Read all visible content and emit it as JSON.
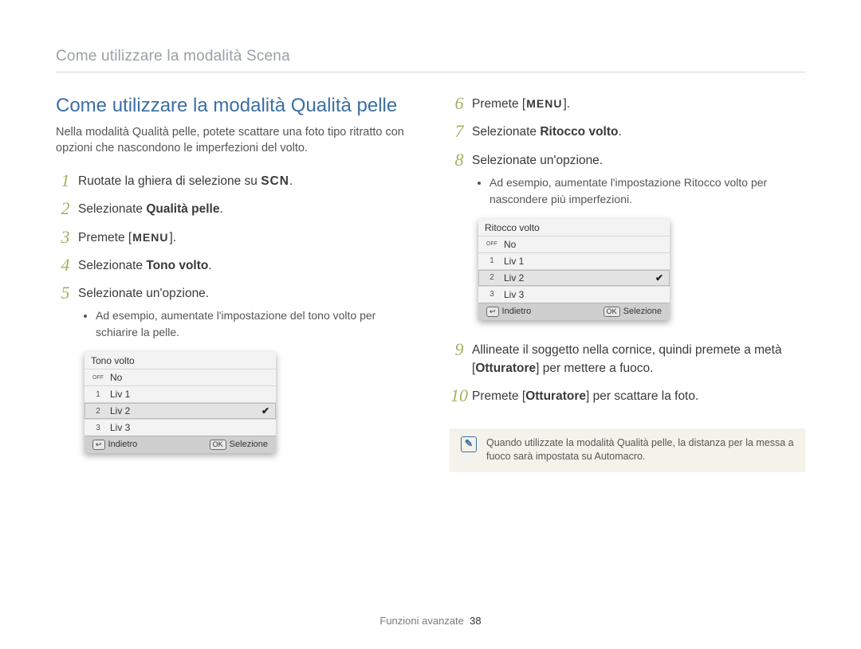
{
  "breadcrumb": "Come utilizzare la modalità Scena",
  "section_title": "Come utilizzare la modalità Qualità pelle",
  "intro": "Nella modalità Qualità pelle, potete scattare una foto tipo ritratto con opzioni che nascondono le imperfezioni del volto.",
  "left_steps": {
    "s1": {
      "num": "1",
      "pre": "Ruotate la ghiera di selezione su ",
      "chip": "SCN",
      "post": "."
    },
    "s2": {
      "num": "2",
      "pre": "Selezionate ",
      "bold": "Qualità pelle",
      "post": "."
    },
    "s3": {
      "num": "3",
      "pre": "Premete [",
      "chip": "MENU",
      "post": "]."
    },
    "s4": {
      "num": "4",
      "pre": "Selezionate ",
      "bold": "Tono volto",
      "post": "."
    },
    "s5": {
      "num": "5",
      "text": "Selezionate un'opzione.",
      "bullet": "Ad esempio, aumentate l'impostazione del tono volto per schiarire la pelle."
    }
  },
  "right_steps": {
    "s6": {
      "num": "6",
      "pre": "Premete [",
      "chip": "MENU",
      "post": "]."
    },
    "s7": {
      "num": "7",
      "pre": "Selezionate ",
      "bold": "Ritocco volto",
      "post": "."
    },
    "s8": {
      "num": "8",
      "text": "Selezionate un'opzione.",
      "bullet": "Ad esempio, aumentate l'impostazione Ritocco volto per nascondere più imperfezioni."
    },
    "s9": {
      "num": "9",
      "pre": "Allineate il soggetto nella cornice, quindi premete a metà [",
      "bold": "Otturatore",
      "post": "] per mettere a fuoco."
    },
    "s10": {
      "num": "10",
      "pre": "Premete [",
      "bold": "Otturatore",
      "post": "] per scattare la foto."
    }
  },
  "lcd_left": {
    "title": "Tono volto",
    "rows": [
      {
        "icon": "OFF",
        "label": "No",
        "selected": false
      },
      {
        "icon": "1",
        "label": "Liv 1",
        "selected": false
      },
      {
        "icon": "2",
        "label": "Liv 2",
        "selected": true
      },
      {
        "icon": "3",
        "label": "Liv 3",
        "selected": false
      }
    ],
    "footer_back_key": "↩",
    "footer_back": "Indietro",
    "footer_ok_key": "OK",
    "footer_ok": "Selezione"
  },
  "lcd_right": {
    "title": "Ritocco volto",
    "rows": [
      {
        "icon": "OFF",
        "label": "No",
        "selected": false
      },
      {
        "icon": "1",
        "label": "Liv 1",
        "selected": false
      },
      {
        "icon": "2",
        "label": "Liv 2",
        "selected": true
      },
      {
        "icon": "3",
        "label": "Liv 3",
        "selected": false
      }
    ],
    "footer_back_key": "↩",
    "footer_back": "Indietro",
    "footer_ok_key": "OK",
    "footer_ok": "Selezione"
  },
  "note": "Quando utilizzate la modalità Qualità pelle, la distanza per la messa a fuoco sarà impostata su Automacro.",
  "footer_section": "Funzioni avanzate",
  "footer_page": "38"
}
